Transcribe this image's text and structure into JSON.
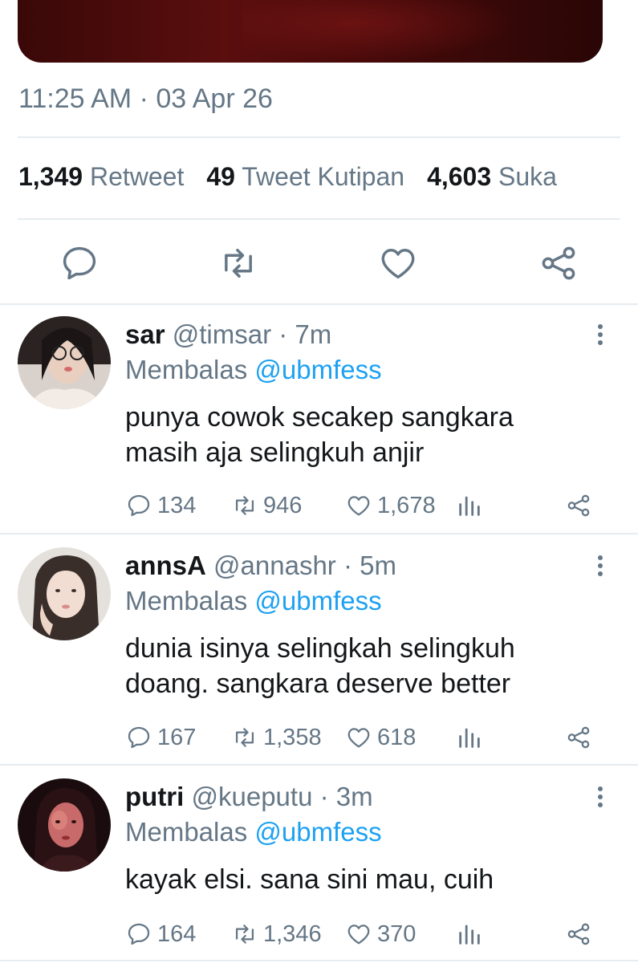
{
  "tweet": {
    "timestamp": "11:25 AM · 03 Apr 26",
    "stats": {
      "retweets_count": "1,349",
      "retweets_label": "Retweet",
      "quotes_count": "49",
      "quotes_label": "Tweet Kutipan",
      "likes_count": "4,603",
      "likes_label": "Suka"
    },
    "actions": [
      "reply-icon",
      "retweet-icon",
      "like-icon",
      "share-icon"
    ]
  },
  "replies": [
    {
      "name": "sar",
      "handle": "@timsar · 7m",
      "reply_prefix": "Membalas",
      "reply_to": "@ubmfess",
      "text_line1": "punya cowok secakep sangkara",
      "text_line2": "masih aja selingkuh anjir",
      "replies": "134",
      "retweets": "946",
      "likes": "1,678"
    },
    {
      "name": "annsA",
      "handle": "@annashr · 5m",
      "reply_prefix": "Membalas",
      "reply_to": "@ubmfess",
      "text_line1": "dunia isinya selingkah selingkuh",
      "text_line2": "doang. sangkara deserve better",
      "replies": "167",
      "retweets": "1,358",
      "likes": "618"
    },
    {
      "name": "putri",
      "handle": "@kueputu · 3m",
      "reply_prefix": "Membalas",
      "reply_to": "@ubmfess",
      "text_line1": "kayak elsi. sana sini mau, cuih",
      "text_line2": "",
      "replies": "164",
      "retweets": "1,346",
      "likes": "370"
    }
  ],
  "colors": {
    "accent": "#1da1f2",
    "secondary_text": "#657786",
    "primary_text": "#14171a",
    "divider": "#e6ecf0"
  }
}
